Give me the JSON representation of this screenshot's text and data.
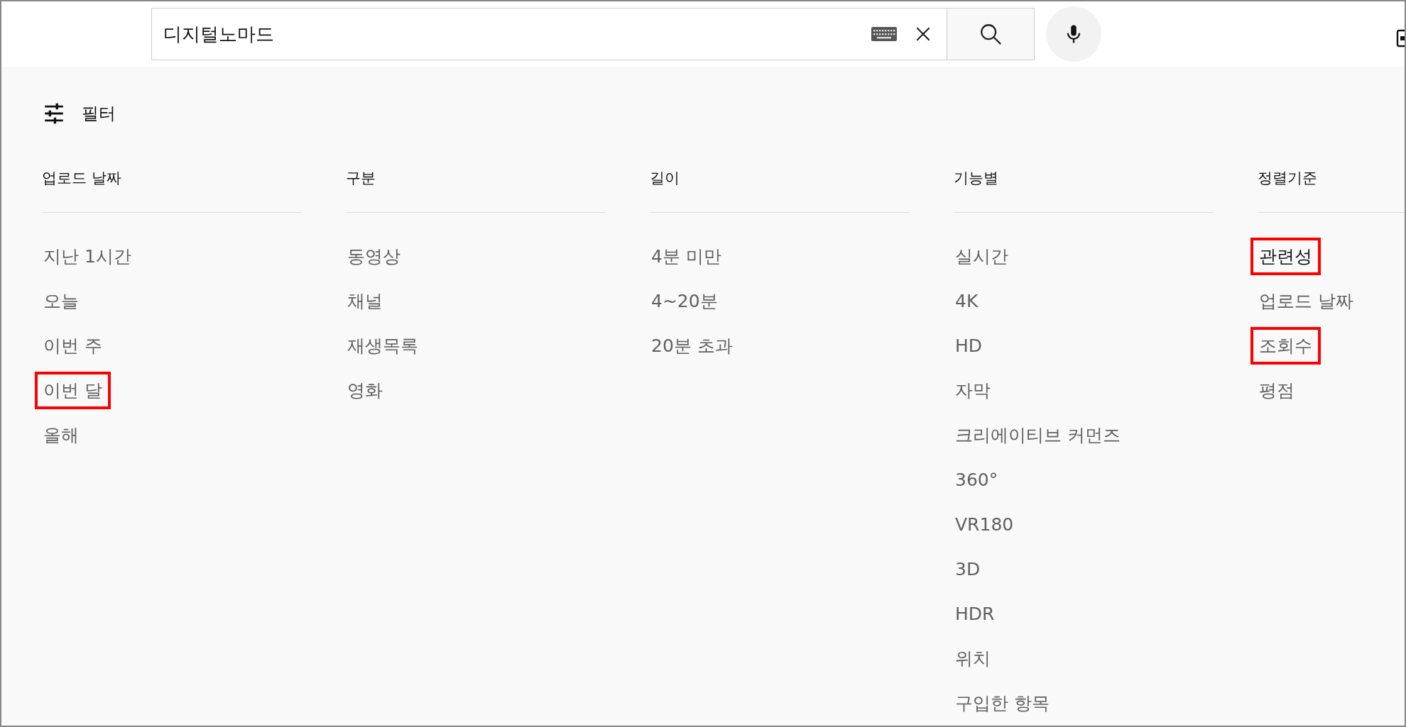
{
  "search": {
    "value": "디지털노마드"
  },
  "filter_header": {
    "label": "필터"
  },
  "filter_groups": [
    {
      "title": "업로드 날짜",
      "options": [
        {
          "label": "지난 1시간",
          "selected": false,
          "highlighted": false
        },
        {
          "label": "오늘",
          "selected": false,
          "highlighted": false
        },
        {
          "label": "이번 주",
          "selected": false,
          "highlighted": false
        },
        {
          "label": "이번 달",
          "selected": false,
          "highlighted": true
        },
        {
          "label": "올해",
          "selected": false,
          "highlighted": false
        }
      ]
    },
    {
      "title": "구분",
      "options": [
        {
          "label": "동영상",
          "selected": false,
          "highlighted": false
        },
        {
          "label": "채널",
          "selected": false,
          "highlighted": false
        },
        {
          "label": "재생목록",
          "selected": false,
          "highlighted": false
        },
        {
          "label": "영화",
          "selected": false,
          "highlighted": false
        }
      ]
    },
    {
      "title": "길이",
      "options": [
        {
          "label": "4분 미만",
          "selected": false,
          "highlighted": false
        },
        {
          "label": "4~20분",
          "selected": false,
          "highlighted": false
        },
        {
          "label": "20분 초과",
          "selected": false,
          "highlighted": false
        }
      ]
    },
    {
      "title": "기능별",
      "options": [
        {
          "label": "실시간",
          "selected": false,
          "highlighted": false
        },
        {
          "label": "4K",
          "selected": false,
          "highlighted": false
        },
        {
          "label": "HD",
          "selected": false,
          "highlighted": false
        },
        {
          "label": "자막",
          "selected": false,
          "highlighted": false
        },
        {
          "label": "크리에이티브 커먼즈",
          "selected": false,
          "highlighted": false
        },
        {
          "label": "360°",
          "selected": false,
          "highlighted": false
        },
        {
          "label": "VR180",
          "selected": false,
          "highlighted": false
        },
        {
          "label": "3D",
          "selected": false,
          "highlighted": false
        },
        {
          "label": "HDR",
          "selected": false,
          "highlighted": false
        },
        {
          "label": "위치",
          "selected": false,
          "highlighted": false
        },
        {
          "label": "구입한 항목",
          "selected": false,
          "highlighted": false
        }
      ]
    },
    {
      "title": "정렬기준",
      "options": [
        {
          "label": "관련성",
          "selected": true,
          "highlighted": true
        },
        {
          "label": "업로드 날짜",
          "selected": false,
          "highlighted": false
        },
        {
          "label": "조회수",
          "selected": false,
          "highlighted": true
        },
        {
          "label": "평점",
          "selected": false,
          "highlighted": false
        }
      ]
    }
  ]
}
